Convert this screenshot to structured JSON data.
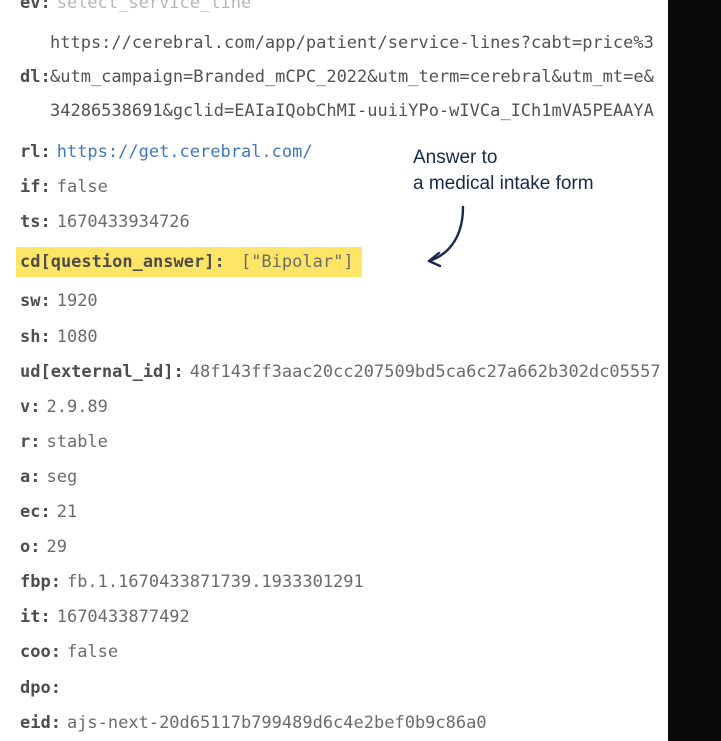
{
  "rows": {
    "ev": {
      "key": "ev:",
      "value": "select_service_line"
    },
    "dl_key": "dl:",
    "url": {
      "line1": "https://cerebral.com/app/patient/service-lines?cabt=price%3",
      "line2": "&utm_campaign=Branded_mCPC_2022&utm_term=cerebral&utm_mt=e&",
      "line3": "34286538691&gclid=EAIaIQobChMI-uuiiYPo-wIVCa_ICh1mVA5PEAAYA"
    },
    "rl": {
      "key": "rl:",
      "value": "https://get.cerebral.com/"
    },
    "if_": {
      "key": "if:",
      "value": "false"
    },
    "ts": {
      "key": "ts:",
      "value": "1670433934726"
    },
    "qa": {
      "key": "cd[question_answer]:",
      "value": "[\"Bipolar\"]"
    },
    "sw": {
      "key": "sw:",
      "value": "1920"
    },
    "sh": {
      "key": "sh:",
      "value": "1080"
    },
    "ud": {
      "key": "ud[external_id]:",
      "value": "48f143ff3aac20cc207509bd5ca6c27a662b302dc05557"
    },
    "v": {
      "key": "v:",
      "value": "2.9.89"
    },
    "r": {
      "key": "r:",
      "value": "stable"
    },
    "a": {
      "key": "a:",
      "value": "seg"
    },
    "ec": {
      "key": "ec:",
      "value": "21"
    },
    "o": {
      "key": "o:",
      "value": "29"
    },
    "fbp": {
      "key": "fbp:",
      "value": "fb.1.1670433871739.1933301291"
    },
    "it": {
      "key": "it:",
      "value": "1670433877492"
    },
    "coo": {
      "key": "coo:",
      "value": "false"
    },
    "dpo": {
      "key": "dpo:",
      "value": ""
    },
    "eid": {
      "key": "eid:",
      "value": "ajs-next-20d65117b799489d6c4e2bef0b9c86a0"
    }
  },
  "annotation": {
    "line1": "Answer to",
    "line2": "a medical intake form"
  },
  "colors": {
    "highlight": "#ffe566",
    "annotation_text": "#172a4d",
    "link": "#4079bf"
  }
}
